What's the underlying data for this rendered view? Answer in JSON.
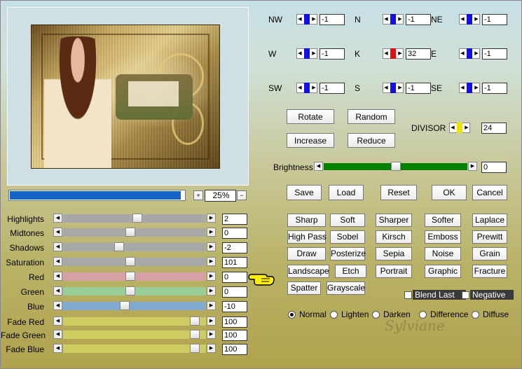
{
  "zoom": {
    "plus_label": "+",
    "minus_label": "−",
    "value": "25%"
  },
  "progress": {
    "fraction": 0.98
  },
  "directions": [
    {
      "id": "nw",
      "label": "NW",
      "value": "-1",
      "indicator": "#1010e0"
    },
    {
      "id": "n",
      "label": "N",
      "value": "-1",
      "indicator": "#1010e0"
    },
    {
      "id": "ne",
      "label": "NE",
      "value": "-1",
      "indicator": "#1010e0"
    },
    {
      "id": "w",
      "label": "W",
      "value": "-1",
      "indicator": "#1010e0"
    },
    {
      "id": "k",
      "label": "K",
      "value": "32",
      "indicator": "#e01010"
    },
    {
      "id": "e",
      "label": "E",
      "value": "-1",
      "indicator": "#1010e0"
    },
    {
      "id": "sw",
      "label": "SW",
      "value": "-1",
      "indicator": "#1010e0"
    },
    {
      "id": "s",
      "label": "S",
      "value": "-1",
      "indicator": "#1010e0"
    },
    {
      "id": "se",
      "label": "SE",
      "value": "-1",
      "indicator": "#1010e0"
    }
  ],
  "divisor": {
    "label": "DIVISOR",
    "value": "24",
    "indicator": "#f0e000"
  },
  "matrix_buttons": {
    "rotate": "Rotate",
    "random": "Random",
    "increase": "Increase",
    "reduce": "Reduce"
  },
  "brightness": {
    "label": "Brightness",
    "value": "0",
    "fraction": 0.5,
    "color": "#008000"
  },
  "actions": {
    "save": "Save",
    "load": "Load",
    "reset": "Reset",
    "ok": "OK",
    "cancel": "Cancel"
  },
  "adjustments": [
    {
      "label": "Highlights",
      "value": "2",
      "fraction": 0.52,
      "color": "#a8a8a8"
    },
    {
      "label": "Midtones",
      "value": "0",
      "fraction": 0.47,
      "color": "#a8a8a8"
    },
    {
      "label": "Shadows",
      "value": "-2",
      "fraction": 0.39,
      "color": "#a8a8a8"
    },
    {
      "label": "Saturation",
      "value": "101",
      "fraction": 0.47,
      "color": "#a8a8a8"
    },
    {
      "label": "Red",
      "value": "0",
      "fraction": 0.47,
      "color": "#d7a0a4"
    },
    {
      "label": "Green",
      "value": "0",
      "fraction": 0.47,
      "color": "#98cc98"
    },
    {
      "label": "Blue",
      "value": "-10",
      "fraction": 0.43,
      "color": "#80a8d0"
    },
    {
      "label": "Fade Red",
      "value": "100",
      "fraction": 0.92,
      "color": "#cccc60"
    },
    {
      "label": "Fade Green",
      "value": "100",
      "fraction": 0.92,
      "color": "#cccc60"
    },
    {
      "label": "Fade Blue",
      "value": "100",
      "fraction": 0.92,
      "color": "#cccc60"
    }
  ],
  "presets": [
    [
      "Sharp",
      "Soft",
      "Sharper",
      "Softer",
      "Laplace"
    ],
    [
      "High Pass",
      "Sobel",
      "Kirsch",
      "Emboss",
      "Prewitt"
    ],
    [
      "Draw",
      "Posterize",
      "Sepia",
      "Noise",
      "Grain"
    ],
    [
      "Landscape",
      "Etch",
      "Portrait",
      "Graphic",
      "Fracture"
    ],
    [
      "Spatter",
      "Grayscale"
    ]
  ],
  "options": {
    "blend_last": "Blend Last",
    "negative": "Negative"
  },
  "blend_modes": [
    {
      "label": "Normal",
      "selected": true
    },
    {
      "label": "Lighten",
      "selected": false
    },
    {
      "label": "Darken",
      "selected": false
    },
    {
      "label": "Difference",
      "selected": false
    },
    {
      "label": "Diffuse",
      "selected": false
    }
  ],
  "watermark": "Sylviane",
  "pointer_icon": "hand-pointer-icon"
}
